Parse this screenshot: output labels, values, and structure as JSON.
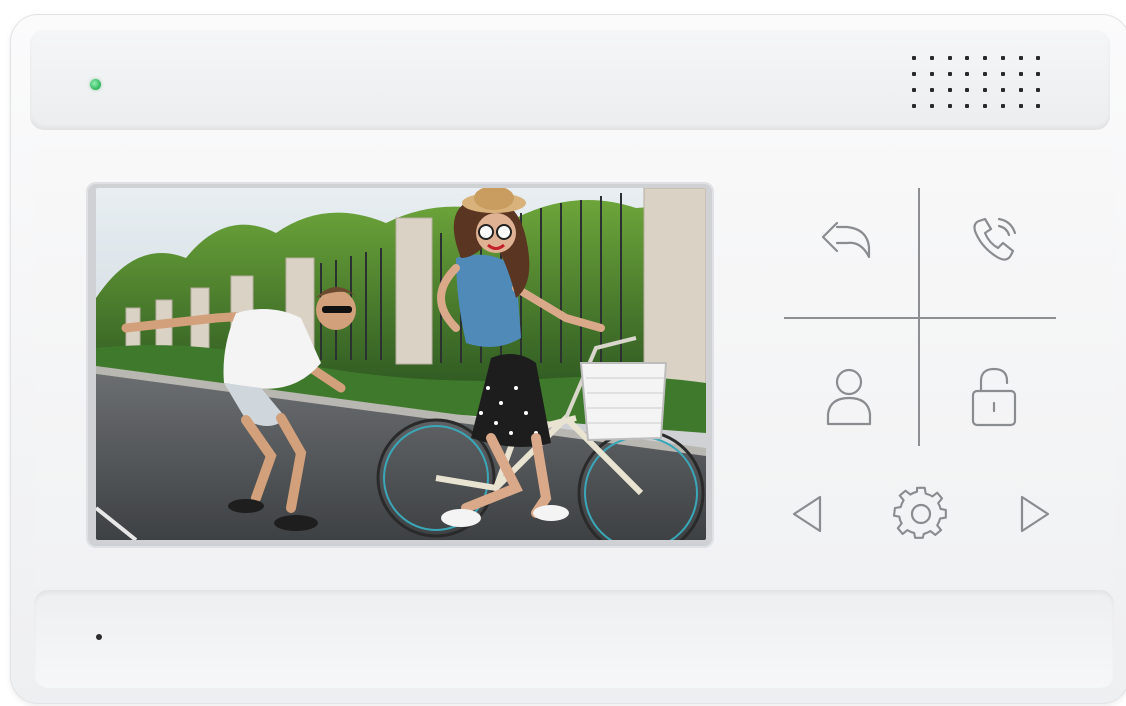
{
  "device": {
    "colors": {
      "body": "#f4f5f6",
      "icon_stroke": "#8a8c90",
      "led": "#2fb35c",
      "divider": "#8d8f93"
    }
  },
  "status": {
    "led": "power-led-green"
  },
  "screen": {
    "content": "video-feed-image"
  },
  "controls": {
    "icons": {
      "back": "back-arrow-icon",
      "call": "phone-call-icon",
      "monitor": "person-icon",
      "unlock": "unlock-padlock-icon",
      "previous": "triangle-left-icon",
      "settings": "gear-icon",
      "next": "triangle-right-icon"
    }
  }
}
